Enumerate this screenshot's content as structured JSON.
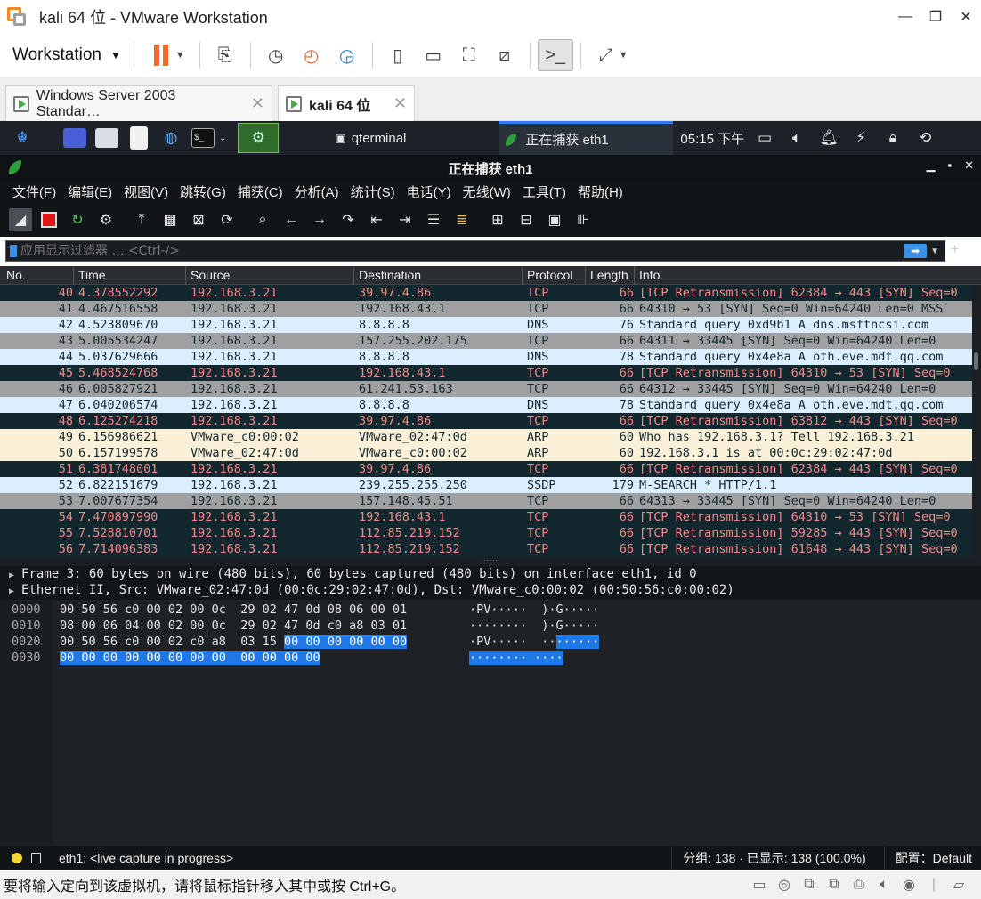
{
  "vmware": {
    "window_title": "kali 64 位 - VMware Workstation",
    "menu_label": "Workstation",
    "tabs": [
      {
        "label": "Windows Server 2003 Standar…"
      },
      {
        "label": "kali 64 位"
      }
    ],
    "status_message": "要将输入定向到该虚拟机，请将鼠标指针移入其中或按 Ctrl+G。"
  },
  "kali_panel": {
    "tasks": [
      "qterminal",
      "正在捕获 eth1"
    ],
    "clock": "05:15 下午"
  },
  "wireshark": {
    "title": "正在捕获 eth1",
    "menu": [
      "文件(F)",
      "编辑(E)",
      "视图(V)",
      "跳转(G)",
      "捕获(C)",
      "分析(A)",
      "统计(S)",
      "电话(Y)",
      "无线(W)",
      "工具(T)",
      "帮助(H)"
    ],
    "filter_placeholder": "应用显示过滤器 … <Ctrl-/>",
    "columns": [
      "No.",
      "Time",
      "Source",
      "Destination",
      "Protocol",
      "Length",
      "Info"
    ],
    "packets": [
      {
        "no": "40",
        "time": "4.378552292",
        "src": "192.168.3.21",
        "dst": "39.97.4.86",
        "proto": "TCP",
        "len": "66",
        "info": "[TCP Retransmission] 62384 → 443 [SYN] Seq=0",
        "style": "bad"
      },
      {
        "no": "41",
        "time": "4.467516558",
        "src": "192.168.3.21",
        "dst": "192.168.43.1",
        "proto": "TCP",
        "len": "66",
        "info": "64310 → 53 [SYN] Seq=0 Win=64240 Len=0 MSS",
        "style": "gray"
      },
      {
        "no": "42",
        "time": "4.523809670",
        "src": "192.168.3.21",
        "dst": "8.8.8.8",
        "proto": "DNS",
        "len": "76",
        "info": "Standard query 0xd9b1 A dns.msftncsi.com",
        "style": "blue"
      },
      {
        "no": "43",
        "time": "5.005534247",
        "src": "192.168.3.21",
        "dst": "157.255.202.175",
        "proto": "TCP",
        "len": "66",
        "info": "64311 → 33445 [SYN] Seq=0 Win=64240 Len=0",
        "style": "gray"
      },
      {
        "no": "44",
        "time": "5.037629666",
        "src": "192.168.3.21",
        "dst": "8.8.8.8",
        "proto": "DNS",
        "len": "78",
        "info": "Standard query 0x4e8a A oth.eve.mdt.qq.com",
        "style": "blue"
      },
      {
        "no": "45",
        "time": "5.468524768",
        "src": "192.168.3.21",
        "dst": "192.168.43.1",
        "proto": "TCP",
        "len": "66",
        "info": "[TCP Retransmission] 64310 → 53 [SYN] Seq=0",
        "style": "bad"
      },
      {
        "no": "46",
        "time": "6.005827921",
        "src": "192.168.3.21",
        "dst": "61.241.53.163",
        "proto": "TCP",
        "len": "66",
        "info": "64312 → 33445 [SYN] Seq=0 Win=64240 Len=0",
        "style": "gray"
      },
      {
        "no": "47",
        "time": "6.040206574",
        "src": "192.168.3.21",
        "dst": "8.8.8.8",
        "proto": "DNS",
        "len": "78",
        "info": "Standard query 0x4e8a A oth.eve.mdt.qq.com",
        "style": "blue"
      },
      {
        "no": "48",
        "time": "6.125274218",
        "src": "192.168.3.21",
        "dst": "39.97.4.86",
        "proto": "TCP",
        "len": "66",
        "info": "[TCP Retransmission] 63812 → 443 [SYN] Seq=0",
        "style": "bad"
      },
      {
        "no": "49",
        "time": "6.156986621",
        "src": "VMware_c0:00:02",
        "dst": "VMware_02:47:0d",
        "proto": "ARP",
        "len": "60",
        "info": "Who has 192.168.3.1? Tell 192.168.3.21",
        "style": "arp"
      },
      {
        "no": "50",
        "time": "6.157199578",
        "src": "VMware_02:47:0d",
        "dst": "VMware_c0:00:02",
        "proto": "ARP",
        "len": "60",
        "info": "192.168.3.1 is at 00:0c:29:02:47:0d",
        "style": "arp"
      },
      {
        "no": "51",
        "time": "6.381748001",
        "src": "192.168.3.21",
        "dst": "39.97.4.86",
        "proto": "TCP",
        "len": "66",
        "info": "[TCP Retransmission] 62384 → 443 [SYN] Seq=0",
        "style": "bad"
      },
      {
        "no": "52",
        "time": "6.822151679",
        "src": "192.168.3.21",
        "dst": "239.255.255.250",
        "proto": "SSDP",
        "len": "179",
        "info": "M-SEARCH * HTTP/1.1",
        "style": "blue"
      },
      {
        "no": "53",
        "time": "7.007677354",
        "src": "192.168.3.21",
        "dst": "157.148.45.51",
        "proto": "TCP",
        "len": "66",
        "info": "64313 → 33445 [SYN] Seq=0 Win=64240 Len=0",
        "style": "gray"
      },
      {
        "no": "54",
        "time": "7.470897990",
        "src": "192.168.3.21",
        "dst": "192.168.43.1",
        "proto": "TCP",
        "len": "66",
        "info": "[TCP Retransmission] 64310 → 53 [SYN] Seq=0",
        "style": "bad"
      },
      {
        "no": "55",
        "time": "7.528810701",
        "src": "192.168.3.21",
        "dst": "112.85.219.152",
        "proto": "TCP",
        "len": "66",
        "info": "[TCP Retransmission] 59285 → 443 [SYN] Seq=0",
        "style": "bad"
      },
      {
        "no": "56",
        "time": "7.714096383",
        "src": "192.168.3.21",
        "dst": "112.85.219.152",
        "proto": "TCP",
        "len": "66",
        "info": "[TCP Retransmission] 61648 → 443 [SYN] Seq=0",
        "style": "bad"
      }
    ],
    "details": [
      "Frame 3: 60 bytes on wire (480 bits), 60 bytes captured (480 bits) on interface eth1, id 0",
      "Ethernet II, Src: VMware_02:47:0d (00:0c:29:02:47:0d), Dst: VMware_c0:00:02 (00:50:56:c0:00:02)"
    ],
    "bytes": [
      {
        "offset": "0000",
        "hex": "00 50 56 c0 00 02 00 0c  29 02 47 0d 08 06 00 01",
        "hex_hl": "",
        "ascii": "·PV·····  )·G·····",
        "ascii_hl": ""
      },
      {
        "offset": "0010",
        "hex": "08 00 06 04 00 02 00 0c  29 02 47 0d c0 a8 03 01",
        "hex_hl": "",
        "ascii": "········  )·G·····",
        "ascii_hl": ""
      },
      {
        "offset": "0020",
        "hex": "00 50 56 c0 00 02 c0 a8  03 15 ",
        "hex_hl": "00 00 00 00 00 00",
        "ascii": "·PV·····  ··",
        "ascii_hl": "······"
      },
      {
        "offset": "0030",
        "hex": "",
        "hex_hl": "00 00 00 00 00 00 00 00  00 00 00 00",
        "ascii": "",
        "ascii_hl": "········ ····"
      }
    ],
    "status": {
      "interface": "eth1: <live capture in progress>",
      "counts": "分组: 138 · 已显示: 138 (100.0%)",
      "profile": "配置：Default"
    }
  },
  "colors": {
    "row_bad_bg": "#12272e",
    "row_bad_fg": "#f78787",
    "row_gray_bg": "#a0a0a0",
    "row_gray_fg": "#12272e",
    "row_blue_bg": "#daeeff",
    "row_blue_fg": "#12272e",
    "row_arp_bg": "#faf0d7",
    "row_arp_fg": "#12272e",
    "accent": "#f26a24"
  }
}
